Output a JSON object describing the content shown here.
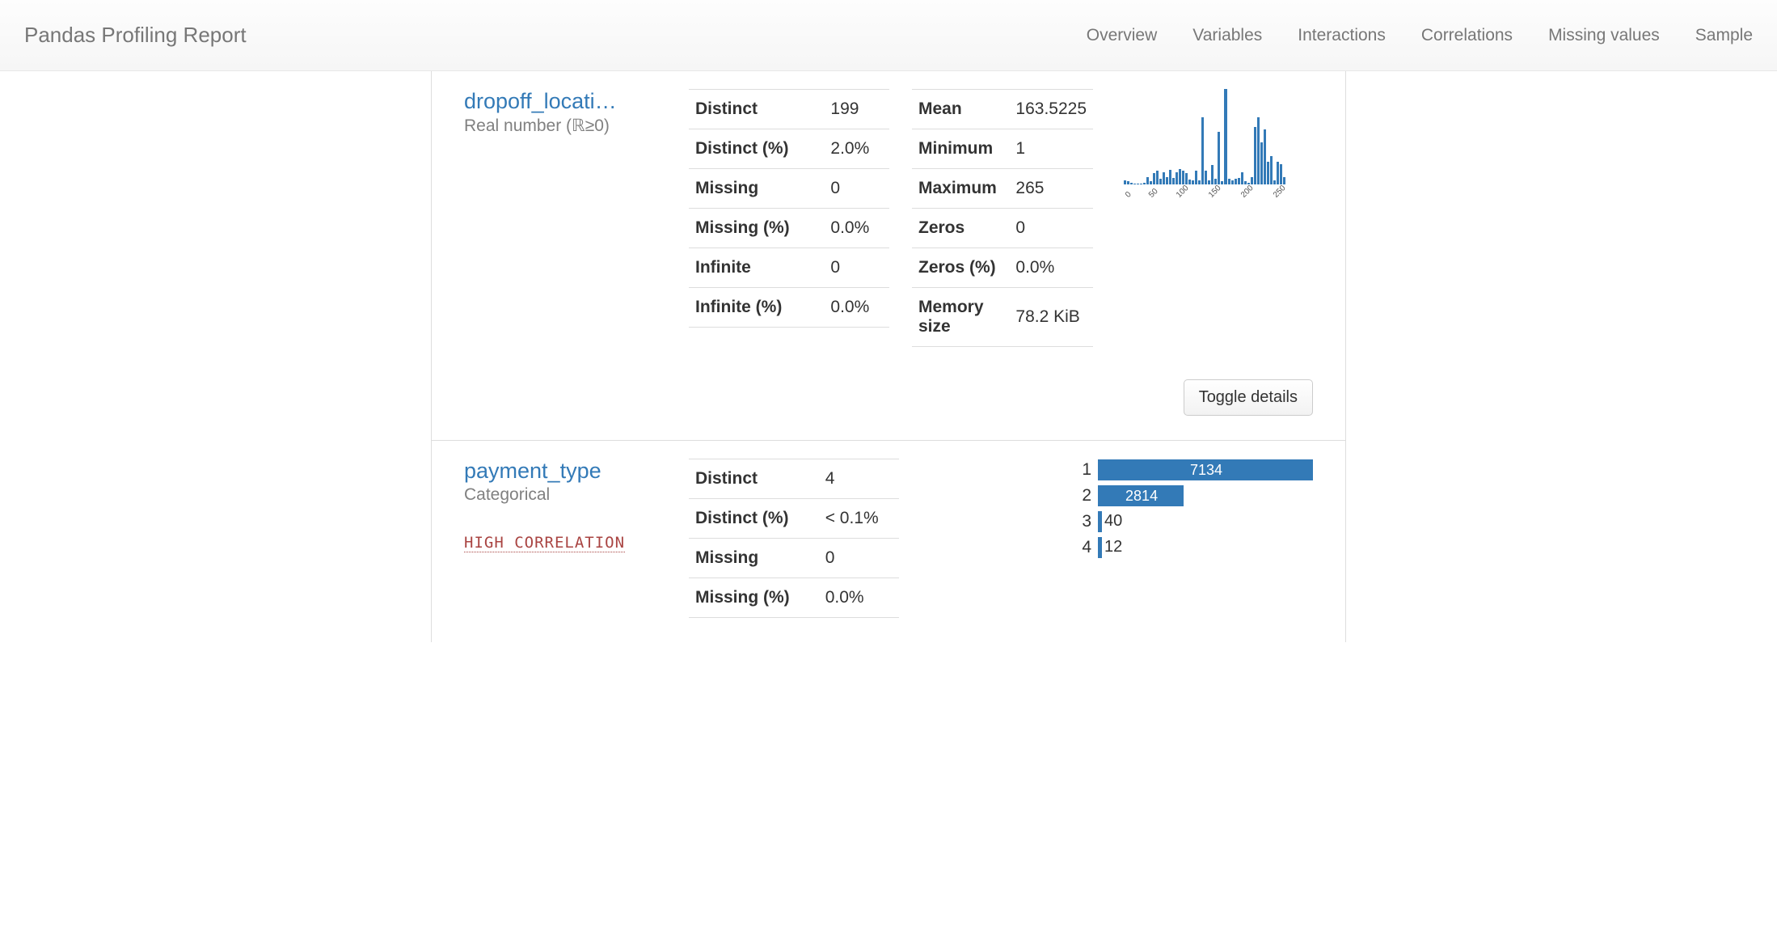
{
  "nav": {
    "brand": "Pandas Profiling Report",
    "links": [
      "Overview",
      "Variables",
      "Interactions",
      "Correlations",
      "Missing values",
      "Sample"
    ]
  },
  "toggle_label": "Toggle details",
  "var1": {
    "name": "dropoff_locati…",
    "type_label": "Real number (ℝ≥0)",
    "stats_left": [
      {
        "k": "Distinct",
        "v": "199"
      },
      {
        "k": "Distinct (%)",
        "v": "2.0%"
      },
      {
        "k": "Missing",
        "v": "0"
      },
      {
        "k": "Missing (%)",
        "v": "0.0%"
      },
      {
        "k": "Infinite",
        "v": "0"
      },
      {
        "k": "Infinite (%)",
        "v": "0.0%"
      }
    ],
    "stats_right": [
      {
        "k": "Mean",
        "v": "163.5225"
      },
      {
        "k": "Minimum",
        "v": "1"
      },
      {
        "k": "Maximum",
        "v": "265"
      },
      {
        "k": "Zeros",
        "v": "0"
      },
      {
        "k": "Zeros (%)",
        "v": "0.0%"
      },
      {
        "k": "Memory size",
        "v": "78.2 KiB"
      }
    ]
  },
  "var2": {
    "name": "payment_type",
    "type_label": "Categorical",
    "warning": "HIGH CORRELATION",
    "stats": [
      {
        "k": "Distinct",
        "v": "4"
      },
      {
        "k": "Distinct (%)",
        "v": "< 0.1%"
      },
      {
        "k": "Missing",
        "v": "0"
      },
      {
        "k": "Missing (%)",
        "v": "0.0%"
      }
    ],
    "freq": [
      {
        "label": "1",
        "count": 7134
      },
      {
        "label": "2",
        "count": 2814
      },
      {
        "label": "3",
        "count": 40
      },
      {
        "label": "4",
        "count": 12
      }
    ]
  },
  "chart_data": {
    "type": "bar",
    "title": "",
    "xlabel": "",
    "ylabel": "",
    "ticks": [
      "0",
      "50",
      "100",
      "150",
      "200",
      "250"
    ],
    "xlim": [
      0,
      265
    ],
    "bins": 50,
    "values": [
      4,
      3,
      2,
      1,
      1,
      1,
      2,
      8,
      3,
      12,
      14,
      6,
      13,
      8,
      15,
      7,
      13,
      16,
      14,
      12,
      5,
      4,
      14,
      4,
      70,
      14,
      4,
      20,
      6,
      55,
      3,
      100,
      6,
      4,
      6,
      7,
      13,
      3,
      2,
      8,
      60,
      70,
      44,
      58,
      24,
      30,
      4,
      24,
      21,
      8
    ]
  }
}
